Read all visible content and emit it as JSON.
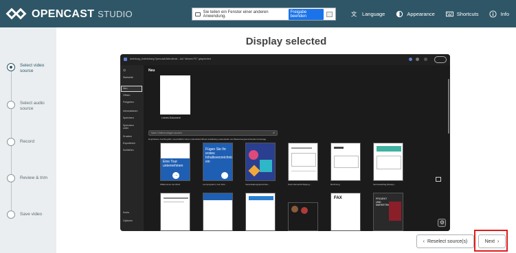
{
  "header": {
    "logo_main": "OPENCAST",
    "logo_sub": "STUDIO",
    "share_text": "Sie teilen ein Fenster einer anderen Anwendung.",
    "share_stop": "Freigabe beenden",
    "nav": [
      {
        "label": "Language",
        "icon": "language-icon"
      },
      {
        "label": "Appearance",
        "icon": "appearance-icon"
      },
      {
        "label": "Shortcuts",
        "icon": "keyboard-icon"
      },
      {
        "label": "Info",
        "icon": "info-icon"
      }
    ]
  },
  "steps": [
    {
      "label": "Select video source",
      "active": true
    },
    {
      "label": "Select audio source",
      "active": false
    },
    {
      "label": "Record",
      "active": false
    },
    {
      "label": "Review & trim",
      "active": false
    },
    {
      "label": "Save video",
      "active": false
    }
  ],
  "main": {
    "title": "Display selected"
  },
  "preview": {
    "window_title": "Anleitung_Unterleitung Opencast/Aktivdienst – Auf \"diesem PC\" gespeichert",
    "side_items": [
      "Startseite",
      "Neu",
      "Öffnen",
      "Freigeben",
      "Informationen",
      "Speichern",
      "Speichern unter",
      "Drucken",
      "Exportieren",
      "Schließen",
      "Konto",
      "Optionen"
    ],
    "neu_label": "Neu",
    "blank_label": "Leeres Dokument",
    "search_placeholder": "Nach Onlinevorlagen suchen",
    "filters": "Empfohlene Suchbegriffe:  Geschäftlich  Karten  Handzettel  Briefe  Ausbildung  Lebensläufe und Bewerbungsanschreiben  Feiertage",
    "templates_row1": [
      "Willkommen bei Word",
      "Lernprogramm zum Erst...",
      "Veranstaltungsbroschüre...",
      "Stornobenachrichtigung...",
      "Rechnung",
      "Serviceauftrag (Design..."
    ],
    "tpl1_text": "Eine Tour unternehmen",
    "tpl2_text": "Fügen Sie Ihr erstes Inhaltsverzeichnis ein",
    "tpl_fax": "FAX",
    "tpl_project": "PROJEKT UND MARKETINGPLAN"
  },
  "footer": {
    "reselect_label": "Reselect source(s)",
    "next_label": "Next"
  },
  "colors": {
    "header_bg": "#2f5667",
    "sidebar_bg": "#eaeef0",
    "highlight": "#e11a1a"
  }
}
